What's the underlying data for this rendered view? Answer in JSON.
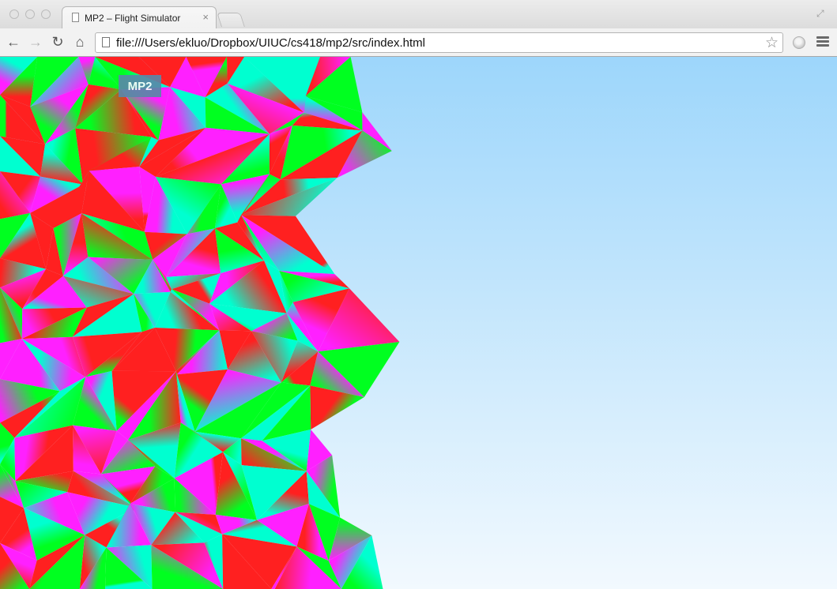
{
  "window": {
    "tab_title": "MP2 – Flight Simulator",
    "tab_close": "×"
  },
  "toolbar": {
    "back": "←",
    "forward": "→",
    "reload": "↻",
    "home": "⌂",
    "url": "file:///Users/ekluo/Dropbox/UIUC/cs418/mp2/src/index.html",
    "star": "☆",
    "icons": [
      "back-icon",
      "forward-icon",
      "reload-icon",
      "home-icon",
      "page-icon",
      "star-icon",
      "extension-icon",
      "menu-icon"
    ]
  },
  "page": {
    "badge": "MP2"
  },
  "colors": {
    "sky_top": "#9dd6fb",
    "sky_bottom": "#f2f9fe",
    "terrain_red": "#ff2020",
    "terrain_green": "#00ff20",
    "terrain_magenta": "#ff20ff",
    "terrain_cyan": "#00ffd0",
    "badge_bg": "#5a88a8"
  }
}
